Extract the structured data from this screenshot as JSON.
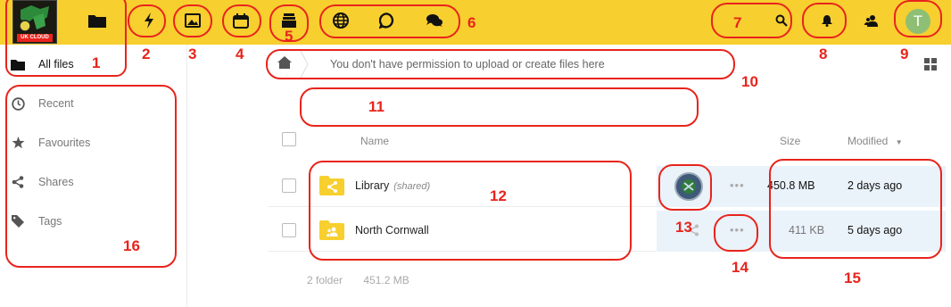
{
  "header": {
    "logo_text": "UK CLOUD",
    "app_icons": [
      "folder-icon",
      "activity-icon",
      "gallery-icon",
      "calendar-icon",
      "deck-icon",
      "globe-icon",
      "talk-icon",
      "chat-icon"
    ],
    "right_icons": [
      "search-icon",
      "notification-bell-icon",
      "contacts-icon"
    ],
    "avatar_letter": "T",
    "colors": {
      "bar": "#f7cf2f",
      "avatar": "#8fbf75",
      "annotation": "#e8241c"
    }
  },
  "sidebar": {
    "items": [
      {
        "label": "All files",
        "icon": "folder-icon",
        "active": true
      },
      {
        "label": "Recent",
        "icon": "clock-icon",
        "active": false
      },
      {
        "label": "Favourites",
        "icon": "star-icon",
        "active": false
      },
      {
        "label": "Shares",
        "icon": "share-icon",
        "active": false
      },
      {
        "label": "Tags",
        "icon": "tag-icon",
        "active": false
      }
    ]
  },
  "breadcrumb": {
    "home_icon": "home-icon",
    "message": "You don't have permission to upload or create files here"
  },
  "table": {
    "headers": {
      "name": "Name",
      "size": "Size",
      "modified": "Modified"
    },
    "rows": [
      {
        "name": "Library",
        "tag": "(shared)",
        "size": "450.8 MB",
        "modified": "2 days ago",
        "icon": "shared-folder-icon"
      },
      {
        "name": "North Cornwall",
        "tag": "",
        "size": "411 KB",
        "modified": "5 days ago",
        "icon": "group-folder-icon"
      }
    ],
    "summary_count": "2 folder",
    "summary_size": "451.2 MB"
  },
  "annotations": [
    "1",
    "2",
    "3",
    "4",
    "5",
    "6",
    "7",
    "8",
    "9",
    "10",
    "11",
    "12",
    "13",
    "14",
    "15",
    "16"
  ]
}
